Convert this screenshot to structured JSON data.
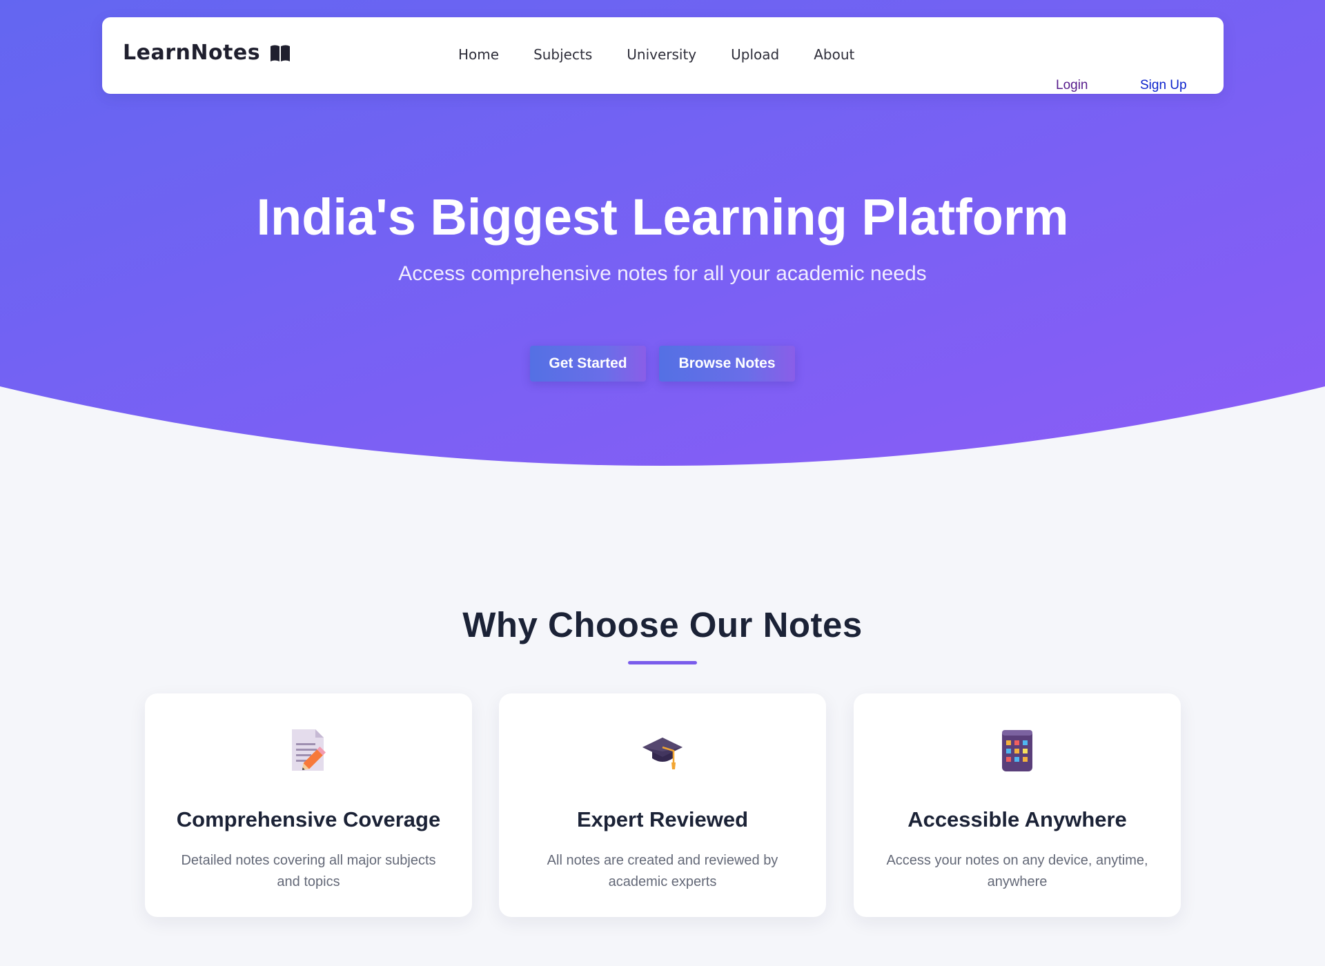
{
  "brand": {
    "name": "LearnNotes",
    "icon": "open-book-icon"
  },
  "nav": {
    "links": [
      "Home",
      "Subjects",
      "University",
      "Upload",
      "About"
    ],
    "login_label": "Login",
    "signup_label": "Sign Up"
  },
  "hero": {
    "title": "India's Biggest Learning Platform",
    "subtitle": "Access comprehensive notes for all your academic needs",
    "get_started_label": "Get Started",
    "browse_notes_label": "Browse Notes"
  },
  "features": {
    "title": "Why Choose Our Notes",
    "cards": [
      {
        "icon": "memo-pencil-icon",
        "title": "Comprehensive Coverage",
        "description": "Detailed notes covering all major subjects and topics"
      },
      {
        "icon": "graduation-cap-icon",
        "title": "Expert Reviewed",
        "description": "All notes are created and reviewed by academic experts"
      },
      {
        "icon": "mobile-device-icon",
        "title": "Accessible Anywhere",
        "description": "Access your notes on any device, anytime, anywhere"
      }
    ]
  },
  "colors": {
    "hero_gradient_start": "#6366f1",
    "hero_gradient_end": "#8b5cf6",
    "page_background": "#f5f6fa",
    "heading_text": "#1b2236",
    "accent_underline": "#7a5ceb",
    "login_link": "#551a8b",
    "signup_link": "#0b22cc"
  }
}
